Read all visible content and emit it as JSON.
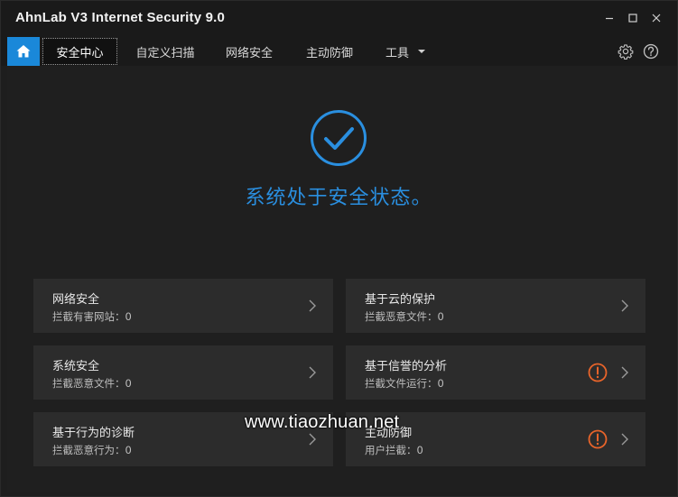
{
  "window": {
    "title": "AhnLab V3 Internet Security 9.0"
  },
  "nav": {
    "tabs": [
      {
        "label": "安全中心",
        "active": true
      },
      {
        "label": "自定义扫描"
      },
      {
        "label": "网络安全"
      },
      {
        "label": "主动防御"
      },
      {
        "label": "工具",
        "has_dropdown": true
      }
    ],
    "icons": [
      "home-icon",
      "gear-icon",
      "help-icon"
    ]
  },
  "status": {
    "icon": "check-circle-icon",
    "message": "系统处于安全状态。"
  },
  "cards": [
    {
      "title": "网络安全",
      "subtitle": "拦截有害网站：0",
      "warning": false
    },
    {
      "title": "基于云的保护",
      "subtitle": "拦截恶意文件：0",
      "warning": false
    },
    {
      "title": "系统安全",
      "subtitle": "拦截恶意文件：0",
      "warning": false
    },
    {
      "title": "基于信誉的分析",
      "subtitle": "拦截文件运行：0",
      "warning": true
    },
    {
      "title": "基于行为的诊断",
      "subtitle": "拦截恶意行为：0",
      "warning": false
    },
    {
      "title": "主动防御",
      "subtitle": "用户拦截：0",
      "warning": true
    }
  ],
  "watermark": {
    "text": "www.tiaozhuan.net"
  },
  "colors": {
    "accent": "#1a88d9",
    "status_blue": "#2a8fe0",
    "warning": "#e8642a",
    "card_bg": "#2c2c2c",
    "background": "#1f1f1f"
  }
}
